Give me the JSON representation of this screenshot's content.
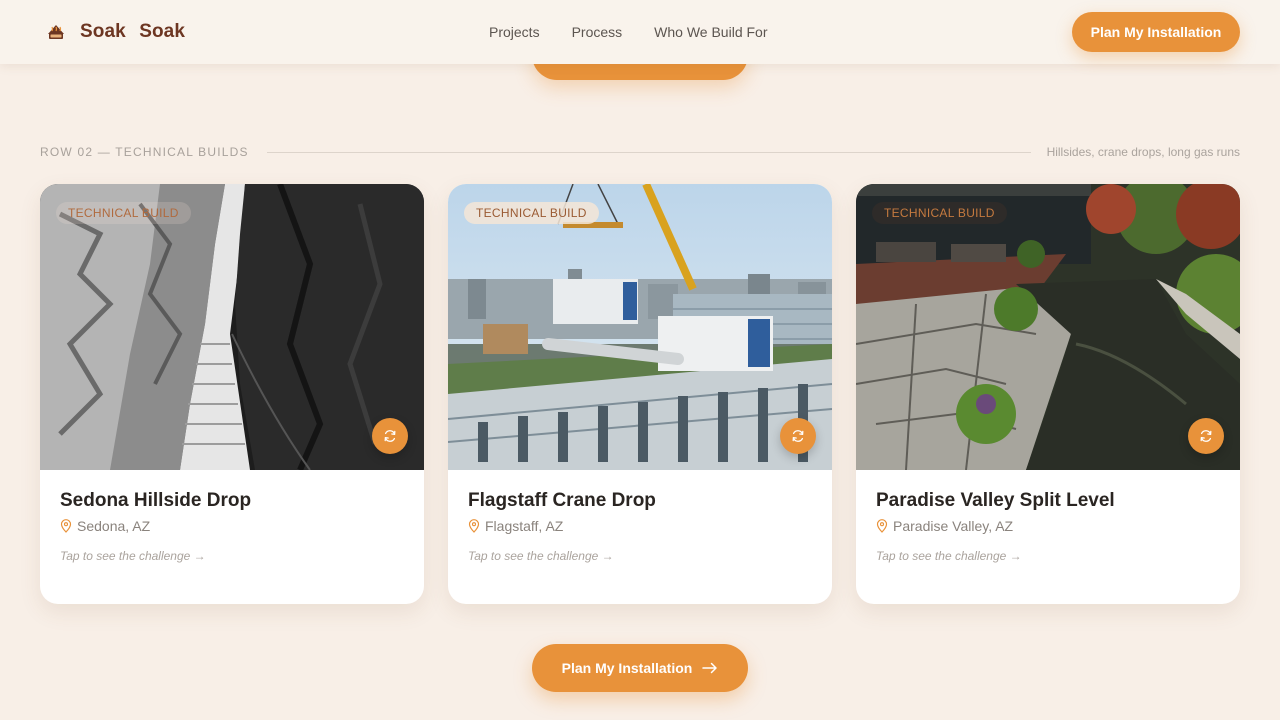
{
  "header": {
    "brand": "Soak Soak",
    "brand_icon": "hot-tub-icon",
    "nav": [
      "Projects",
      "Process",
      "Who We Build For"
    ],
    "cta_label": "Plan My Installation"
  },
  "section": {
    "label": "ROW 02 — TECHNICAL BUILDS",
    "note": "Hillsides, crane drops, long gas runs"
  },
  "cards": [
    {
      "tag": "TECHNICAL BUILD",
      "title": "Sedona Hillside Drop",
      "location": "Sedona, AZ",
      "hint": "Tap to see the challenge →",
      "flip_icon": "refresh-icon"
    },
    {
      "tag": "TECHNICAL BUILD",
      "title": "Flagstaff Crane Drop",
      "location": "Flagstaff, AZ",
      "hint": "Tap to see the challenge →",
      "flip_icon": "refresh-icon"
    },
    {
      "tag": "TECHNICAL BUILD",
      "title": "Paradise Valley Split Level",
      "location": "Paradise Valley, AZ",
      "hint": "Tap to see the challenge →",
      "flip_icon": "refresh-icon"
    }
  ],
  "bottom_cta": {
    "label": "Plan My Installation",
    "icon": "arrow-right-icon"
  },
  "colors": {
    "accent": "#e8923a",
    "brand": "#6d3622",
    "background": "#f8efe7"
  }
}
